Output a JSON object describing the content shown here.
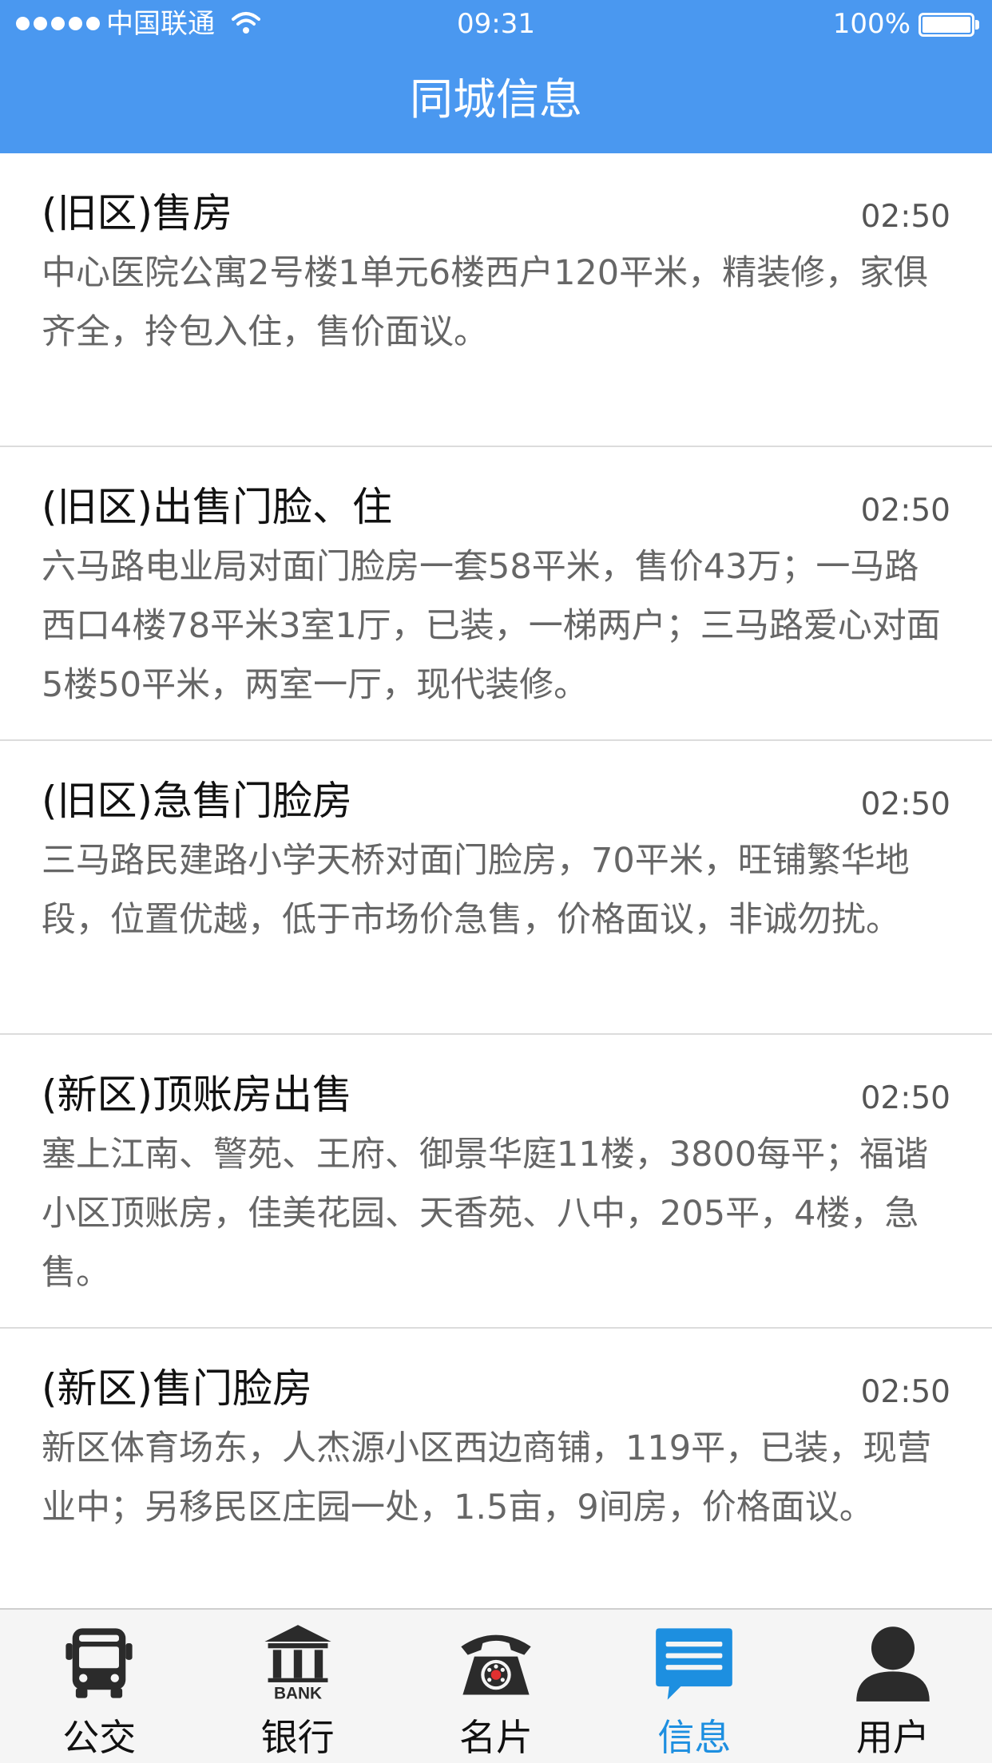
{
  "status_bar": {
    "carrier": "中国联通",
    "time": "09:31",
    "battery": "100%"
  },
  "header": {
    "title": "同城信息"
  },
  "list": {
    "items": [
      {
        "title": "(旧区)售房",
        "time": "02:50",
        "desc": "中心医院公寓2号楼1单元6楼西户120平米，精装修，家俱齐全，拎包入住，售价面议。"
      },
      {
        "title": "(旧区)出售门脸、住",
        "time": "02:50",
        "desc": "六马路电业局对面门脸房一套58平米，售价43万；一马路西口4楼78平米3室1厅，已装，一梯两户；三马路爱心对面5楼50平米，两室一厅，现代装修。"
      },
      {
        "title": "(旧区)急售门脸房",
        "time": "02:50",
        "desc": "三马路民建路小学天桥对面门脸房，70平米，旺铺繁华地段，位置优越，低于市场价急售，价格面议，非诚勿扰。"
      },
      {
        "title": "(新区)顶账房出售",
        "time": "02:50",
        "desc": "塞上江南、警苑、王府、御景华庭11楼，3800每平；福谐小区顶账房，佳美花园、天香苑、八中，205平，4楼，急售。"
      },
      {
        "title": "(新区)售门脸房",
        "time": "02:50",
        "desc": "新区体育场东，人杰源小区西边商铺，119平，已装，现营业中；另移民区庄园一处，1.5亩，9间房，价格面议。"
      }
    ]
  },
  "tab_bar": {
    "tabs": [
      {
        "label": "公交",
        "icon": "bus-icon"
      },
      {
        "label": "银行",
        "icon": "bank-icon"
      },
      {
        "label": "名片",
        "icon": "telephone-icon"
      },
      {
        "label": "信息",
        "icon": "message-icon",
        "active": true
      },
      {
        "label": "用户",
        "icon": "user-icon"
      }
    ],
    "bank_icon_text": "BANK"
  },
  "colors": {
    "header_bg": "#4a98f0",
    "active_tab": "#1d8fe0",
    "tab_icon": "#2b2b2b"
  }
}
